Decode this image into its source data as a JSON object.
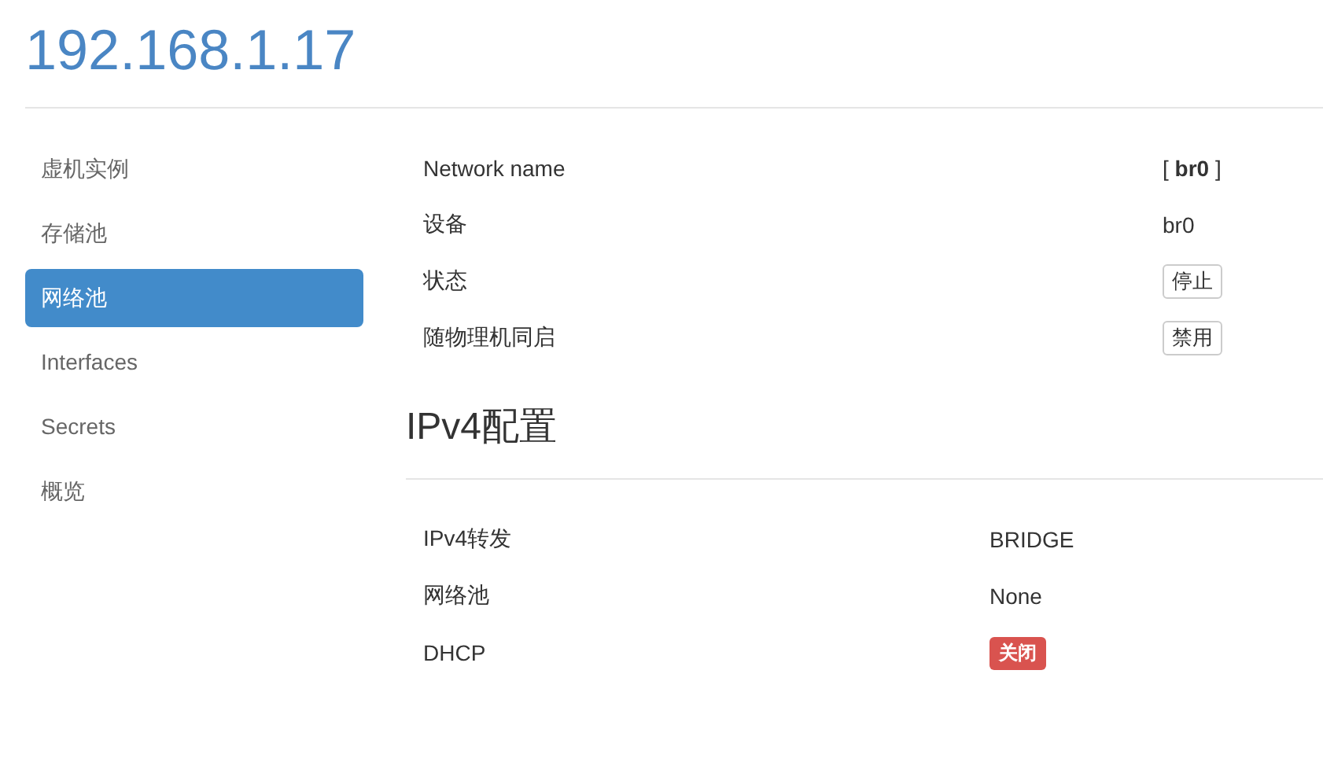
{
  "title": "192.168.1.17",
  "sidebar": {
    "items": [
      {
        "label": "虚机实例",
        "selected": false
      },
      {
        "label": "存储池",
        "selected": false
      },
      {
        "label": "网络池",
        "selected": true
      },
      {
        "label": "Interfaces",
        "selected": false
      },
      {
        "label": "Secrets",
        "selected": false
      },
      {
        "label": "概览",
        "selected": false
      }
    ]
  },
  "network": {
    "rows": [
      {
        "label": "Network name",
        "kind": "text",
        "value": "[ **br0** ]"
      },
      {
        "label": "设备",
        "kind": "text",
        "value": "br0"
      },
      {
        "label": "状态",
        "kind": "button",
        "value": "停止"
      },
      {
        "label": "随物理机同启",
        "kind": "button",
        "value": "禁用"
      }
    ]
  },
  "ipv4": {
    "heading": "IPv4配置",
    "rows": [
      {
        "label": "IPv4转发",
        "kind": "text",
        "value": "BRIDGE"
      },
      {
        "label": "网络池",
        "kind": "text",
        "value": "None"
      },
      {
        "label": "DHCP",
        "kind": "badge",
        "value": "关闭"
      }
    ]
  }
}
